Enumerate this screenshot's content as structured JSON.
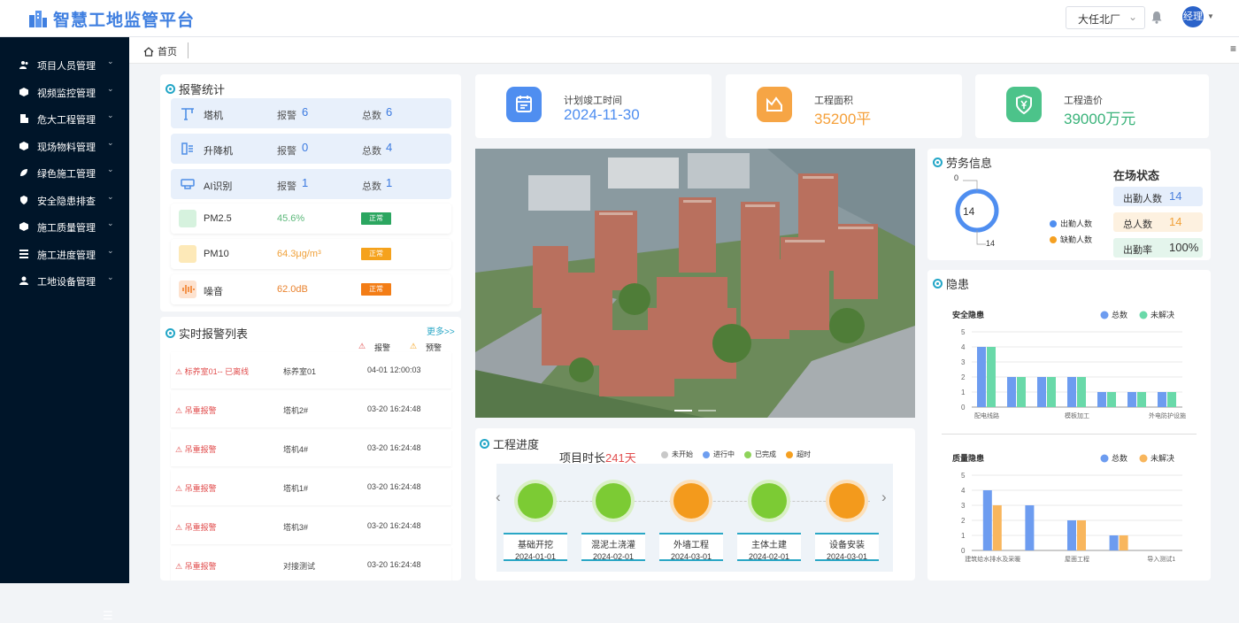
{
  "header": {
    "title": "智慧工地监管平台",
    "site": "大任北厂",
    "user": "经理"
  },
  "sidebar": {
    "items": [
      {
        "label": "项目人员管理",
        "icon": "users-icon"
      },
      {
        "label": "视频监控管理",
        "icon": "camera-icon"
      },
      {
        "label": "危大工程管理",
        "icon": "building-icon"
      },
      {
        "label": "现场物料管理",
        "icon": "box-icon"
      },
      {
        "label": "绿色施工管理",
        "icon": "leaf-icon"
      },
      {
        "label": "安全隐患排查",
        "icon": "shield-icon"
      },
      {
        "label": "施工质量管理",
        "icon": "cube-icon"
      },
      {
        "label": "施工进度管理",
        "icon": "list-icon"
      },
      {
        "label": "工地设备管理",
        "icon": "user-gear-icon"
      }
    ]
  },
  "tabs": {
    "home": "首页"
  },
  "alarm_stats": {
    "title": "报警统计",
    "alarm_label": "报警",
    "total_label": "总数",
    "devices": [
      {
        "name": "塔机",
        "alarm": 6,
        "total": 6
      },
      {
        "name": "升降机",
        "alarm": 0,
        "total": 4
      },
      {
        "name": "AI识别",
        "alarm": 1,
        "total": 1
      }
    ],
    "env": [
      {
        "name": "PM2.5",
        "value": "45.6%",
        "status": "正常",
        "color": "#5cb87a",
        "badge": "#2ba660"
      },
      {
        "name": "PM10",
        "value": "64.3μg/m³",
        "status": "正常",
        "color": "#f0a13a",
        "badge": "#f5a21c"
      },
      {
        "name": "噪音",
        "value": "62.0dB",
        "status": "正常",
        "color": "#e9822d",
        "badge": "#f37d16"
      }
    ]
  },
  "alarm_list": {
    "title": "实时报警列表",
    "more": "更多>>",
    "legend_alarm": "报警",
    "legend_warn": "预警",
    "rows": [
      {
        "type": "标养室01-- 已离线",
        "device": "标养室01",
        "time": "04-01 12:00:03"
      },
      {
        "type": "吊重报警",
        "device": "塔机2#",
        "time": "03-20 16:24:48"
      },
      {
        "type": "吊重报警",
        "device": "塔机4#",
        "time": "03-20 16:24:48"
      },
      {
        "type": "吊重报警",
        "device": "塔机1#",
        "time": "03-20 16:24:48"
      },
      {
        "type": "吊重报警",
        "device": "塔机3#",
        "time": "03-20 16:24:48"
      },
      {
        "type": "吊重报警",
        "device": "对接测试",
        "time": "03-20 16:24:48"
      }
    ]
  },
  "kpis": [
    {
      "label": "计划竣工时间",
      "value": "2024-11-30",
      "color": "#4f8ef0",
      "value_color": "#4f8ef0"
    },
    {
      "label": "工程面积",
      "value": "35200平",
      "color": "#f6a545",
      "value_color": "#f5a03a"
    },
    {
      "label": "工程造价",
      "value": "39000万元",
      "color": "#4cc38a",
      "value_color": "#3ab37a"
    }
  ],
  "progress": {
    "title": "工程进度",
    "duration_label": "项目时长",
    "duration_value": "241天",
    "legend": [
      {
        "label": "未开始",
        "color": "#c8c8c8"
      },
      {
        "label": "进行中",
        "color": "#6e9ef0"
      },
      {
        "label": "已完成",
        "color": "#8ed35a"
      },
      {
        "label": "超时",
        "color": "#f5a021"
      }
    ],
    "milestones": [
      {
        "name": "基础开挖",
        "date": "2024-01-01",
        "color": "#7ccb34"
      },
      {
        "name": "混泥土浇灌",
        "date": "2024-02-01",
        "color": "#7ccb34"
      },
      {
        "name": "外墙工程",
        "date": "2024-03-01",
        "color": "#f39a1c"
      },
      {
        "name": "主体土建",
        "date": "2024-02-01",
        "color": "#7ccb34"
      },
      {
        "name": "设备安装",
        "date": "2024-03-01",
        "color": "#f39a1c"
      }
    ]
  },
  "labor": {
    "title": "劳务信息",
    "gauge_value": "14",
    "gauge_min": "0",
    "gauge_max": "14",
    "legend_in": "出勤人数",
    "legend_absent": "缺勤人数",
    "status_title": "在场状态",
    "stats": [
      {
        "label": "出勤人数",
        "value": "14",
        "bg": "#e5eefb",
        "color": "#4a7fdc"
      },
      {
        "label": "总人数",
        "value": "14",
        "bg": "#fdf1e0",
        "color": "#f0a13a"
      },
      {
        "label": "出勤率",
        "value": "100%",
        "bg": "#e4f5ec",
        "color": "#333"
      }
    ]
  },
  "hazards": {
    "title": "隐患"
  },
  "chart_data": [
    {
      "type": "bar",
      "title": "安全隐患",
      "categories": [
        "配电线路",
        "",
        "",
        "模板加工",
        "",
        "",
        "外电防护设施"
      ],
      "series": [
        {
          "name": "总数",
          "values": [
            4,
            2,
            2,
            2,
            1,
            1,
            1
          ],
          "color": "#6d9cf0"
        },
        {
          "name": "未解决",
          "values": [
            4,
            2,
            2,
            2,
            1,
            1,
            1
          ],
          "color": "#69d9a9"
        }
      ],
      "ylim": [
        0,
        5
      ],
      "yticks": [
        0,
        1,
        2,
        3,
        4,
        5
      ]
    },
    {
      "type": "bar",
      "title": "质量隐患",
      "categories": [
        "建筑给水排水及采暖",
        "",
        "屋面工程",
        "",
        "导入测试1"
      ],
      "series": [
        {
          "name": "总数",
          "values": [
            4,
            3,
            2,
            1,
            0
          ],
          "color": "#6d9cf0"
        },
        {
          "name": "未解决",
          "values": [
            3,
            0,
            2,
            1,
            0
          ],
          "color": "#f8b65d"
        }
      ],
      "ylim": [
        0,
        5
      ],
      "yticks": [
        0,
        1,
        2,
        3,
        4,
        5
      ]
    }
  ]
}
